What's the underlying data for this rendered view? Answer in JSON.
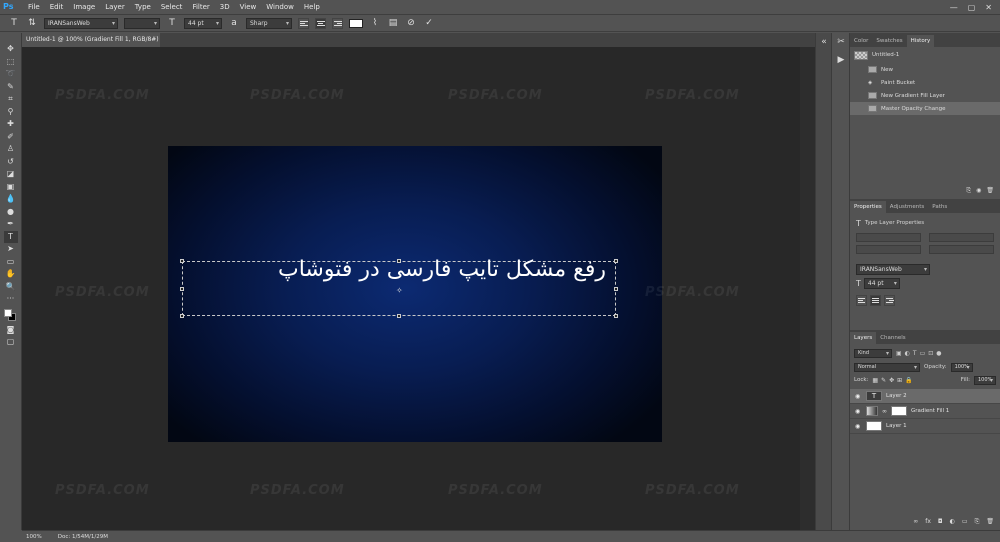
{
  "app": {
    "logo": "Ps"
  },
  "menu": [
    "File",
    "Edit",
    "Image",
    "Layer",
    "Type",
    "Select",
    "Filter",
    "3D",
    "View",
    "Window",
    "Help"
  ],
  "window_controls": [
    "—",
    "▢",
    "✕"
  ],
  "options": {
    "font_family": "IRANSansWeb",
    "font_style": "",
    "font_size": "44 pt",
    "antialias": "Sharp"
  },
  "document": {
    "tab_title": "Untitled-1 @ 100% (Gradient Fill 1, RGB/8#) *",
    "text": "رفع مشکل تایپ فارسی در فتوشاپ",
    "watermark": "PSDFA.COM",
    "gradient_colors": [
      "#0c2a72",
      "#020713"
    ]
  },
  "status": {
    "zoom": "100%",
    "doc": "Doc: 1/54M/1/29M"
  },
  "history_panel": {
    "tabs": [
      "Color",
      "Swatches",
      "History"
    ],
    "snapshot": "Untitled-1",
    "items": [
      "New",
      "Paint Bucket",
      "New Gradient Fill Layer",
      "Master Opacity Change"
    ]
  },
  "properties_panel": {
    "tabs": [
      "Properties",
      "Adjustments",
      "Paths"
    ],
    "title": "Type Layer Properties",
    "font_family": "IRANSansWeb",
    "font_size": "44 pt"
  },
  "layers_panel": {
    "tabs": [
      "Layers",
      "Channels"
    ],
    "filter": "Kind",
    "blend_mode": "Normal",
    "opacity_label": "Opacity:",
    "opacity": "100%",
    "lock_label": "Lock:",
    "fill_label": "Fill:",
    "fill": "100%",
    "layers": [
      {
        "name": "Layer 2",
        "type": "text"
      },
      {
        "name": "Gradient Fill 1",
        "type": "gradient"
      },
      {
        "name": "Layer 1",
        "type": "pixel"
      }
    ]
  }
}
